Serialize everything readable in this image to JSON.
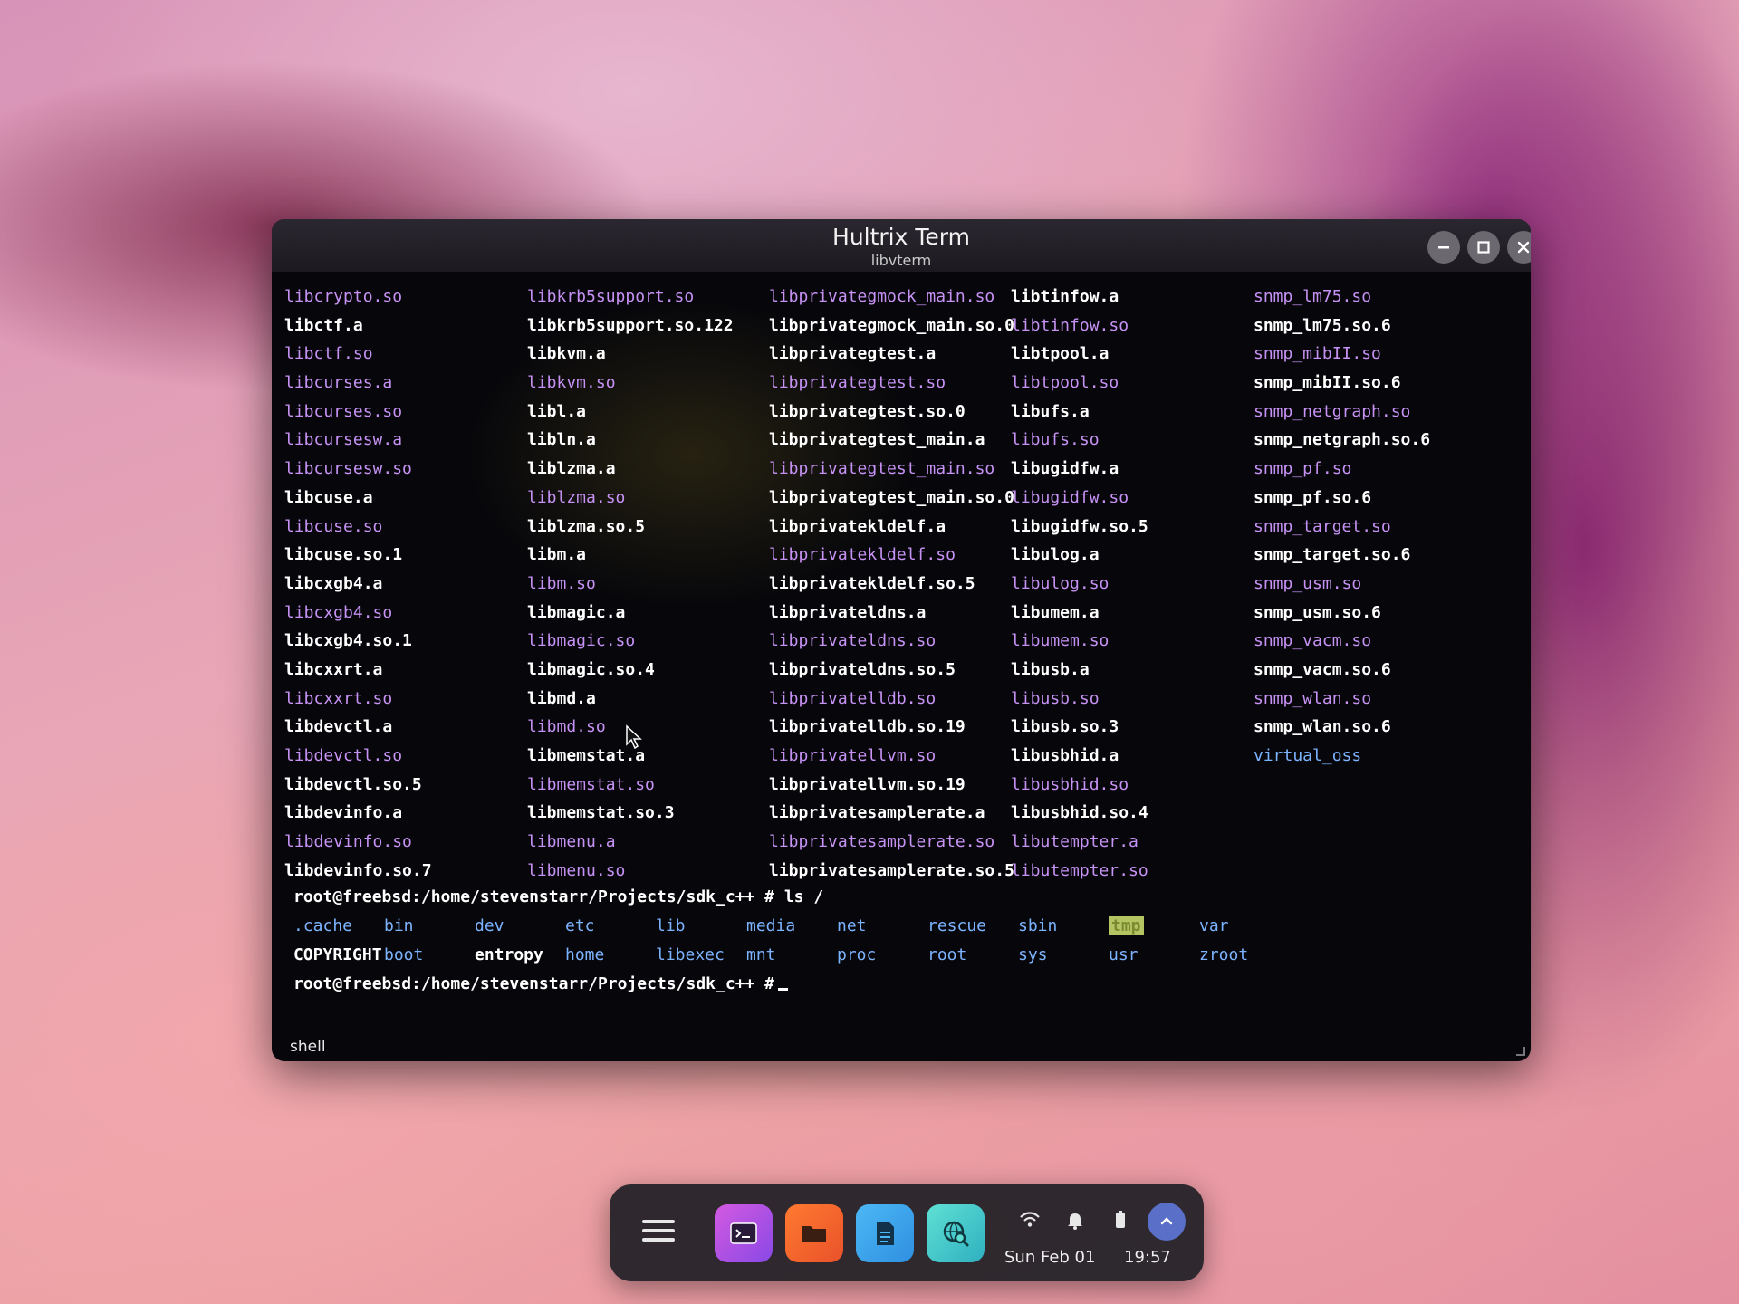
{
  "window": {
    "title": "Hultrix Term",
    "subtitle": "libvterm",
    "status": "shell"
  },
  "terminal": {
    "columns": [
      [
        {
          "t": "libcrypto.so",
          "k": "lnk"
        },
        {
          "t": "libctf.a",
          "k": "file"
        },
        {
          "t": "libctf.so",
          "k": "lnk"
        },
        {
          "t": "libcurses.a",
          "k": "lnk"
        },
        {
          "t": "libcurses.so",
          "k": "lnk"
        },
        {
          "t": "libcursesw.a",
          "k": "lnk"
        },
        {
          "t": "libcursesw.so",
          "k": "lnk"
        },
        {
          "t": "libcuse.a",
          "k": "file"
        },
        {
          "t": "libcuse.so",
          "k": "lnk"
        },
        {
          "t": "libcuse.so.1",
          "k": "file"
        },
        {
          "t": "libcxgb4.a",
          "k": "file"
        },
        {
          "t": "libcxgb4.so",
          "k": "lnk"
        },
        {
          "t": "libcxgb4.so.1",
          "k": "file"
        },
        {
          "t": "libcxxrt.a",
          "k": "file"
        },
        {
          "t": "libcxxrt.so",
          "k": "lnk"
        },
        {
          "t": "libdevctl.a",
          "k": "file"
        },
        {
          "t": "libdevctl.so",
          "k": "lnk"
        },
        {
          "t": "libdevctl.so.5",
          "k": "file"
        },
        {
          "t": "libdevinfo.a",
          "k": "file"
        },
        {
          "t": "libdevinfo.so",
          "k": "lnk"
        },
        {
          "t": "libdevinfo.so.7",
          "k": "file"
        }
      ],
      [
        {
          "t": "libkrb5support.so",
          "k": "lnk"
        },
        {
          "t": "libkrb5support.so.122",
          "k": "file"
        },
        {
          "t": "libkvm.a",
          "k": "file"
        },
        {
          "t": "libkvm.so",
          "k": "lnk"
        },
        {
          "t": "libl.a",
          "k": "file"
        },
        {
          "t": "libln.a",
          "k": "file"
        },
        {
          "t": "liblzma.a",
          "k": "file"
        },
        {
          "t": "liblzma.so",
          "k": "lnk"
        },
        {
          "t": "liblzma.so.5",
          "k": "file"
        },
        {
          "t": "libm.a",
          "k": "file"
        },
        {
          "t": "libm.so",
          "k": "lnk"
        },
        {
          "t": "libmagic.a",
          "k": "file"
        },
        {
          "t": "libmagic.so",
          "k": "lnk"
        },
        {
          "t": "libmagic.so.4",
          "k": "file"
        },
        {
          "t": "libmd.a",
          "k": "file"
        },
        {
          "t": "libmd.so",
          "k": "lnk"
        },
        {
          "t": "libmemstat.a",
          "k": "file"
        },
        {
          "t": "libmemstat.so",
          "k": "lnk"
        },
        {
          "t": "libmemstat.so.3",
          "k": "file"
        },
        {
          "t": "libmenu.a",
          "k": "lnk"
        },
        {
          "t": "libmenu.so",
          "k": "lnk"
        }
      ],
      [
        {
          "t": "libprivategmock_main.so",
          "k": "lnk"
        },
        {
          "t": "libprivategmock_main.so.0",
          "k": "file"
        },
        {
          "t": "libprivategtest.a",
          "k": "file"
        },
        {
          "t": "libprivategtest.so",
          "k": "lnk"
        },
        {
          "t": "libprivategtest.so.0",
          "k": "file"
        },
        {
          "t": "libprivategtest_main.a",
          "k": "file"
        },
        {
          "t": "libprivategtest_main.so",
          "k": "lnk"
        },
        {
          "t": "libprivategtest_main.so.0",
          "k": "file"
        },
        {
          "t": "libprivatekldelf.a",
          "k": "file"
        },
        {
          "t": "libprivatekldelf.so",
          "k": "lnk"
        },
        {
          "t": "libprivatekldelf.so.5",
          "k": "file"
        },
        {
          "t": "libprivateldns.a",
          "k": "file"
        },
        {
          "t": "libprivateldns.so",
          "k": "lnk"
        },
        {
          "t": "libprivateldns.so.5",
          "k": "file"
        },
        {
          "t": "libprivatelldb.so",
          "k": "lnk"
        },
        {
          "t": "libprivatelldb.so.19",
          "k": "file"
        },
        {
          "t": "libprivatellvm.so",
          "k": "lnk"
        },
        {
          "t": "libprivatellvm.so.19",
          "k": "file"
        },
        {
          "t": "libprivatesamplerate.a",
          "k": "file"
        },
        {
          "t": "libprivatesamplerate.so",
          "k": "lnk"
        },
        {
          "t": "libprivatesamplerate.so.5",
          "k": "file"
        }
      ],
      [
        {
          "t": "libtinfow.a",
          "k": "file"
        },
        {
          "t": "libtinfow.so",
          "k": "lnk"
        },
        {
          "t": "libtpool.a",
          "k": "file"
        },
        {
          "t": "libtpool.so",
          "k": "lnk"
        },
        {
          "t": "libufs.a",
          "k": "file"
        },
        {
          "t": "libufs.so",
          "k": "lnk"
        },
        {
          "t": "libugidfw.a",
          "k": "file"
        },
        {
          "t": "libugidfw.so",
          "k": "lnk"
        },
        {
          "t": "libugidfw.so.5",
          "k": "file"
        },
        {
          "t": "libulog.a",
          "k": "file"
        },
        {
          "t": "libulog.so",
          "k": "lnk"
        },
        {
          "t": "libumem.a",
          "k": "file"
        },
        {
          "t": "libumem.so",
          "k": "lnk"
        },
        {
          "t": "libusb.a",
          "k": "file"
        },
        {
          "t": "libusb.so",
          "k": "lnk"
        },
        {
          "t": "libusb.so.3",
          "k": "file"
        },
        {
          "t": "libusbhid.a",
          "k": "file"
        },
        {
          "t": "libusbhid.so",
          "k": "lnk"
        },
        {
          "t": "libusbhid.so.4",
          "k": "file"
        },
        {
          "t": "libutempter.a",
          "k": "lnk"
        },
        {
          "t": "libutempter.so",
          "k": "lnk"
        }
      ],
      [
        {
          "t": "snmp_lm75.so",
          "k": "lnk"
        },
        {
          "t": "snmp_lm75.so.6",
          "k": "file"
        },
        {
          "t": "snmp_mibII.so",
          "k": "lnk"
        },
        {
          "t": "snmp_mibII.so.6",
          "k": "file"
        },
        {
          "t": "snmp_netgraph.so",
          "k": "lnk"
        },
        {
          "t": "snmp_netgraph.so.6",
          "k": "file"
        },
        {
          "t": "snmp_pf.so",
          "k": "lnk"
        },
        {
          "t": "snmp_pf.so.6",
          "k": "file"
        },
        {
          "t": "snmp_target.so",
          "k": "lnk"
        },
        {
          "t": "snmp_target.so.6",
          "k": "file"
        },
        {
          "t": "snmp_usm.so",
          "k": "lnk"
        },
        {
          "t": "snmp_usm.so.6",
          "k": "file"
        },
        {
          "t": "snmp_vacm.so",
          "k": "lnk"
        },
        {
          "t": "snmp_vacm.so.6",
          "k": "file"
        },
        {
          "t": "snmp_wlan.so",
          "k": "lnk"
        },
        {
          "t": "snmp_wlan.so.6",
          "k": "file"
        },
        {
          "t": "virtual_oss",
          "k": "dir"
        }
      ]
    ],
    "prompt1": "root@freebsd:/home/stevenstarr/Projects/sdk_c++ # ls /",
    "ls_row1": [
      {
        "t": ".cache",
        "k": "dir"
      },
      {
        "t": "bin",
        "k": "dir"
      },
      {
        "t": "dev",
        "k": "dir"
      },
      {
        "t": "etc",
        "k": "dir"
      },
      {
        "t": "lib",
        "k": "dir"
      },
      {
        "t": "media",
        "k": "dir"
      },
      {
        "t": "net",
        "k": "dir"
      },
      {
        "t": "rescue",
        "k": "dir"
      },
      {
        "t": "sbin",
        "k": "dir"
      },
      {
        "t": "tmp",
        "k": "ws"
      },
      {
        "t": "var",
        "k": "dir"
      }
    ],
    "ls_row2": [
      {
        "t": "COPYRIGHT",
        "k": "file"
      },
      {
        "t": "boot",
        "k": "dir"
      },
      {
        "t": "entropy",
        "k": "file"
      },
      {
        "t": "home",
        "k": "dir"
      },
      {
        "t": "libexec",
        "k": "dir"
      },
      {
        "t": "mnt",
        "k": "dir"
      },
      {
        "t": "proc",
        "k": "dir"
      },
      {
        "t": "root",
        "k": "dir"
      },
      {
        "t": "sys",
        "k": "dir"
      },
      {
        "t": "usr",
        "k": "dir"
      },
      {
        "t": "zroot",
        "k": "dir"
      }
    ],
    "prompt2": "root@freebsd:/home/stevenstarr/Projects/sdk_c++ #"
  },
  "colors": {
    "symlink": "#c792f5",
    "file": "#ffffff",
    "directory": "#7cb3ff",
    "world_writable_bg": "#b4c463"
  },
  "taskbar": {
    "apps": [
      {
        "name": "terminal",
        "icon": "terminal-icon",
        "color": "#b04fe0"
      },
      {
        "name": "files",
        "icon": "folder-icon",
        "color": "#f06a2a"
      },
      {
        "name": "text editor",
        "icon": "document-icon",
        "color": "#3aa8f0"
      },
      {
        "name": "search",
        "icon": "search-globe-icon",
        "color": "#3fc9c9"
      }
    ],
    "tray": [
      "wifi-icon",
      "bell-icon",
      "battery-icon",
      "chevron-up-icon"
    ],
    "date": "Sun Feb 01",
    "time": "19:57"
  }
}
